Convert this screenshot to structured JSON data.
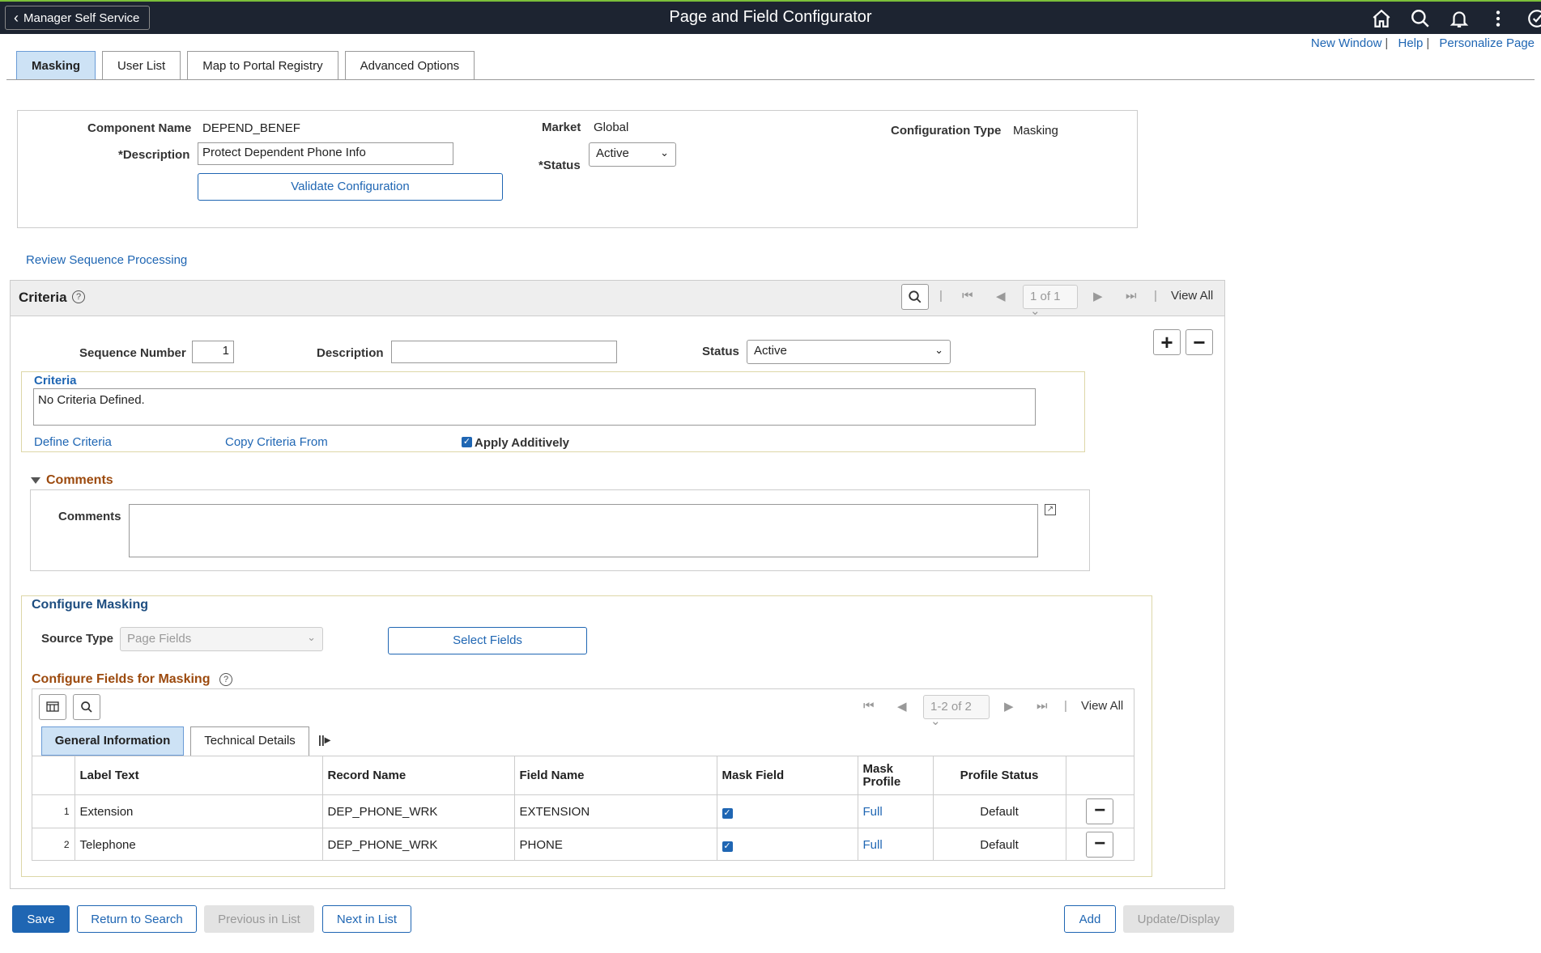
{
  "header": {
    "back_label": "Manager Self Service",
    "title": "Page and Field Configurator",
    "icons": [
      "home-icon",
      "search-icon",
      "bell-icon",
      "more-icon",
      "navbar-icon"
    ],
    "links": [
      "New Window",
      "Help",
      "Personalize Page"
    ]
  },
  "tabs": [
    {
      "label": "Masking",
      "active": true
    },
    {
      "label": "User List",
      "active": false
    },
    {
      "label": "Map to Portal Registry",
      "active": false
    },
    {
      "label": "Advanced Options",
      "active": false
    }
  ],
  "config": {
    "component_name_label": "Component Name",
    "component_name": "DEPEND_BENEF",
    "description_label": "*Description",
    "description": "Protect Dependent Phone Info",
    "validate_button": "Validate Configuration",
    "market_label": "Market",
    "market": "Global",
    "status_label": "*Status",
    "status": "Active",
    "config_type_label": "Configuration Type",
    "config_type": "Masking"
  },
  "review_link": "Review Sequence Processing",
  "criteria_section": {
    "title": "Criteria",
    "pager": "1 of 1",
    "view_all": "View All",
    "sequence_label": "Sequence Number",
    "sequence_value": "1",
    "description_label": "Description",
    "description_value": "",
    "status_label": "Status",
    "status_value": "Active",
    "criteria_label": "Criteria",
    "criteria_text": "No Criteria Defined.",
    "define_link": "Define Criteria",
    "copy_link": "Copy Criteria From",
    "apply_additively": "Apply Additively",
    "apply_checked": true
  },
  "comments": {
    "header": "Comments",
    "label": "Comments",
    "value": ""
  },
  "masking": {
    "title": "Configure Masking",
    "source_type_label": "Source Type",
    "source_type": "Page Fields",
    "select_fields": "Select Fields",
    "fields_title": "Configure Fields for Masking",
    "pager": "1-2 of 2",
    "view_all": "View All",
    "subtabs": [
      "General Information",
      "Technical Details"
    ],
    "columns": [
      "Label Text",
      "Record Name",
      "Field Name",
      "Mask Field",
      "Mask\nProfile",
      "Profile Status"
    ],
    "rows": [
      {
        "num": "1",
        "label": "Extension",
        "record": "DEP_PHONE_WRK",
        "field": "EXTENSION",
        "mask": true,
        "profile": "Full",
        "status": "Default"
      },
      {
        "num": "2",
        "label": "Telephone",
        "record": "DEP_PHONE_WRK",
        "field": "PHONE",
        "mask": true,
        "profile": "Full",
        "status": "Default"
      }
    ]
  },
  "footer": {
    "save": "Save",
    "return": "Return to Search",
    "previous": "Previous in List",
    "next": "Next in List",
    "add": "Add",
    "update": "Update/Display"
  },
  "colors": {
    "header_bg": "#1d2431",
    "link": "#1f66b3",
    "section_orange": "#9c4a0e",
    "primary_button": "#1f66b3"
  }
}
